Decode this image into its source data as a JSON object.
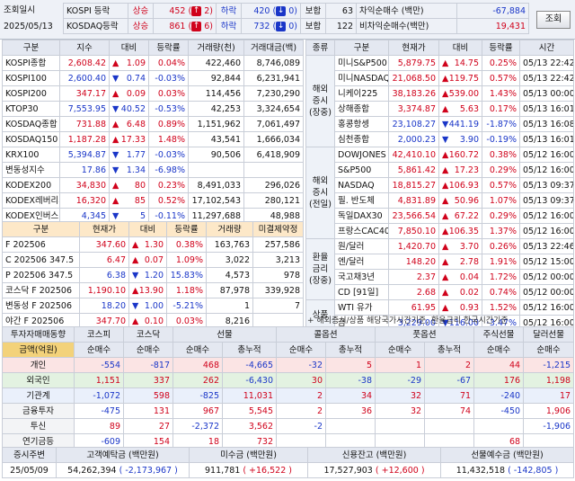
{
  "header": {
    "label1": "조회일시",
    "date": "2025/05/13",
    "rows": [
      {
        "name": "KOSPI 등락",
        "up_label": "상승",
        "up": "452",
        "up_arrow": "2",
        "down_label": "하락",
        "down": "420",
        "down_arrow": "0",
        "flat_label": "보합",
        "flat": "63",
        "arb_label": "차익순매수 (백만)",
        "arb": "-67,884"
      },
      {
        "name": "KOSDAQ등락",
        "up_label": "상승",
        "up": "861",
        "up_arrow": "6",
        "down_label": "하락",
        "down": "732",
        "down_arrow": "0",
        "flat_label": "보합",
        "flat": "122",
        "arb_label": "비차익순매수(백만)",
        "arb": "19,431"
      }
    ],
    "query_button": "조회"
  },
  "index_table": {
    "headers": [
      "구분",
      "지수",
      "대비",
      "등락률",
      "거래량(천)",
      "거래대금(백)"
    ],
    "rows": [
      {
        "name": "KOSPI종합",
        "v": "2,608.42",
        "d": "1.09",
        "r": "0.04%",
        "vol": "422,460",
        "amt": "8,746,089",
        "dir": "up"
      },
      {
        "name": "KOSPI100",
        "v": "2,600.40",
        "d": "0.74",
        "r": "-0.03%",
        "vol": "92,844",
        "amt": "6,231,941",
        "dir": "dn"
      },
      {
        "name": "KOSPI200",
        "v": "347.17",
        "d": "0.09",
        "r": "0.03%",
        "vol": "114,456",
        "amt": "7,230,290",
        "dir": "up"
      },
      {
        "name": "KTOP30",
        "v": "7,553.95",
        "d": "40.52",
        "r": "-0.53%",
        "vol": "42,253",
        "amt": "3,324,654",
        "dir": "dn"
      },
      {
        "name": "KOSDAQ종합",
        "v": "731.88",
        "d": "6.48",
        "r": "0.89%",
        "vol": "1,151,962",
        "amt": "7,061,497",
        "dir": "up"
      },
      {
        "name": "KOSDAQ150",
        "v": "1,187.28",
        "d": "17.33",
        "r": "1.48%",
        "vol": "43,541",
        "amt": "1,666,034",
        "dir": "up"
      },
      {
        "name": "KRX100",
        "v": "5,394.87",
        "d": "1.77",
        "r": "-0.03%",
        "vol": "90,506",
        "amt": "6,418,909",
        "dir": "dn"
      },
      {
        "name": "변동성지수",
        "v": "17.86",
        "d": "1.34",
        "r": "-6.98%",
        "vol": "",
        "amt": "",
        "dir": "dn"
      },
      {
        "name": "KODEX200",
        "v": "34,830",
        "d": "80",
        "r": "0.23%",
        "vol": "8,491,033",
        "amt": "296,026",
        "dir": "up"
      },
      {
        "name": "KODEX레버리지",
        "v": "16,320",
        "d": "85",
        "r": "0.52%",
        "vol": "17,102,543",
        "amt": "280,121",
        "dir": "up"
      },
      {
        "name": "KODEX인버스",
        "v": "4,345",
        "d": "5",
        "r": "-0.11%",
        "vol": "11,297,688",
        "amt": "48,988",
        "dir": "dn"
      }
    ]
  },
  "futures_table": {
    "headers": [
      "구분",
      "현재가",
      "대비",
      "등락률",
      "거래량",
      "미결제약정"
    ],
    "rows": [
      {
        "name": "F 202506",
        "v": "347.60",
        "d": "1.30",
        "r": "0.38%",
        "vol": "163,763",
        "oi": "257,586",
        "dir": "up"
      },
      {
        "name": "C 202506 347.5",
        "v": "6.47",
        "d": "0.07",
        "r": "1.09%",
        "vol": "3,022",
        "oi": "3,213",
        "dir": "up"
      },
      {
        "name": "P 202506 347.5",
        "v": "6.38",
        "d": "1.20",
        "r": "15.83%",
        "vol": "4,573",
        "oi": "978",
        "dir": "dn"
      },
      {
        "name": "코스닥 F 202506",
        "v": "1,190.10",
        "d": "13.90",
        "r": "1.18%",
        "vol": "87,978",
        "oi": "339,928",
        "dir": "up"
      },
      {
        "name": "변동성 F 202506",
        "v": "18.20",
        "d": "1.00",
        "r": "-5.21%",
        "vol": "1",
        "oi": "7",
        "dir": "dn"
      },
      {
        "name": "야간 F 202506",
        "v": "347.70",
        "d": "0.10",
        "r": "0.03%",
        "vol": "8,216",
        "oi": "",
        "dir": "up"
      }
    ]
  },
  "overseas": {
    "headers": [
      "종류",
      "구분",
      "현재가",
      "대비",
      "등락률",
      "시간"
    ],
    "groups": [
      {
        "label": "해외\n증시\n(장중)",
        "rows": [
          {
            "name": "미니S&P500",
            "v": "5,879.75",
            "d": "14.75",
            "r": "0.25%",
            "t": "05/13 22:42",
            "dir": "up"
          },
          {
            "name": "미니NASDAQ",
            "v": "21,068.50",
            "d": "119.75",
            "r": "0.57%",
            "t": "05/13 22:42",
            "dir": "up"
          },
          {
            "name": "니케이225",
            "v": "38,183.26",
            "d": "539.00",
            "r": "1.43%",
            "t": "05/13 00:00",
            "dir": "up"
          },
          {
            "name": "상해종합",
            "v": "3,374.87",
            "d": "5.63",
            "r": "0.17%",
            "t": "05/13 16:01",
            "dir": "up"
          },
          {
            "name": "홍콩항셍",
            "v": "23,108.27",
            "d": "441.19",
            "r": "-1.87%",
            "t": "05/13 16:08",
            "dir": "dn"
          },
          {
            "name": "심천종합",
            "v": "2,000.23",
            "d": "3.90",
            "r": "-0.19%",
            "t": "05/13 16:01",
            "dir": "dn"
          }
        ]
      },
      {
        "label": "해외\n증시\n(전일)",
        "rows": [
          {
            "name": "DOWJONES",
            "v": "42,410.10",
            "d": "160.72",
            "r": "0.38%",
            "t": "05/12 16:00",
            "dir": "up"
          },
          {
            "name": "S&P500",
            "v": "5,861.42",
            "d": "17.23",
            "r": "0.29%",
            "t": "05/12 16:00",
            "dir": "up"
          },
          {
            "name": "NASDAQ",
            "v": "18,815.27",
            "d": "106.93",
            "r": "0.57%",
            "t": "05/13 09:37",
            "dir": "up"
          },
          {
            "name": "필. 반도체",
            "v": "4,831.89",
            "d": "50.96",
            "r": "1.07%",
            "t": "05/13 09:37",
            "dir": "up"
          },
          {
            "name": "독일DAX30",
            "v": "23,566.54",
            "d": "67.22",
            "r": "0.29%",
            "t": "05/12 16:00",
            "dir": "up"
          },
          {
            "name": "프랑스CAC40",
            "v": "7,850.10",
            "d": "106.35",
            "r": "1.37%",
            "t": "05/12 16:00",
            "dir": "up"
          }
        ]
      },
      {
        "label": "환율\n금리\n(장중)",
        "rows": [
          {
            "name": "원/달러",
            "v": "1,420.70",
            "d": "3.70",
            "r": "0.26%",
            "t": "05/13 22:46",
            "dir": "up"
          },
          {
            "name": "엔/달러",
            "v": "148.20",
            "d": "2.78",
            "r": "1.91%",
            "t": "05/12 15:00",
            "dir": "up"
          },
          {
            "name": "국고채3년",
            "v": "2.37",
            "d": "0.04",
            "r": "1.72%",
            "t": "05/12 00:00",
            "dir": "up"
          },
          {
            "name": "CD [91일]",
            "v": "2.68",
            "d": "0.02",
            "r": "0.74%",
            "t": "05/12 00:00",
            "dir": "up"
          }
        ]
      },
      {
        "label": "상품",
        "rows": [
          {
            "name": "WTI 유가",
            "v": "61.95",
            "d": "0.93",
            "r": "1.52%",
            "t": "05/12 16:00",
            "dir": "up"
          },
          {
            "name": "금",
            "v": "3,229.00",
            "d": "116.00",
            "r": "-3.47%",
            "t": "05/12 16:00",
            "dir": "dn"
          }
        ]
      }
    ],
    "note": "+ 해외증시/상품 해당국가시간기준, 환율금리 한국시간기준"
  },
  "investor": {
    "top_headers": [
      "투자자매매동향",
      "코스피",
      "코스닥",
      "선물",
      "콜옵션",
      "풋옵션",
      "주식선물",
      "달러선물"
    ],
    "sub_headers": [
      "금액(억원)",
      "순매수",
      "순매수",
      "순매수",
      "총누적",
      "순매수",
      "총누적",
      "순매수",
      "총누적",
      "순매수",
      "순매수"
    ],
    "rows": [
      {
        "name": "개인",
        "vals": [
          "-554",
          "-817",
          "468",
          "-4,665",
          "-32",
          "5",
          "1",
          "2",
          "44",
          "-1,215"
        ],
        "bg": "pink"
      },
      {
        "name": "외국인",
        "vals": [
          "1,151",
          "337",
          "262",
          "-6,430",
          "30",
          "-38",
          "-29",
          "-67",
          "176",
          "1,198"
        ],
        "bg": "green"
      },
      {
        "name": "기관계",
        "vals": [
          "-1,072",
          "598",
          "-825",
          "11,031",
          "2",
          "34",
          "32",
          "71",
          "-240",
          "17"
        ],
        "bg": "lblue"
      },
      {
        "name": "금융투자",
        "vals": [
          "-475",
          "131",
          "967",
          "5,545",
          "2",
          "36",
          "32",
          "74",
          "-450",
          "1,906"
        ],
        "bg": ""
      },
      {
        "name": "투신",
        "vals": [
          "89",
          "27",
          "-2,372",
          "3,562",
          "-2",
          "",
          "",
          "",
          "",
          "-1,906"
        ],
        "bg": ""
      },
      {
        "name": "연기금등",
        "vals": [
          "-609",
          "154",
          "18",
          "732",
          "",
          "",
          "",
          "",
          "68",
          ""
        ],
        "bg": ""
      }
    ]
  },
  "bottom": {
    "headers": [
      "증시주변",
      "고객예탁금 (백만원)",
      "미수금 (백만원)",
      "신용잔고 (백만원)",
      "선물예수금 (백만원)"
    ],
    "date": "25/05/09",
    "deposit": "54,262,394",
    "deposit_chg": "( -2,173,967 )",
    "unpaid": "911,781",
    "unpaid_chg": "( +16,522 )",
    "credit": "17,527,903",
    "credit_chg": "( +12,600 )",
    "futures_dep": "11,432,518",
    "futures_dep_chg": "( -142,805 )"
  }
}
